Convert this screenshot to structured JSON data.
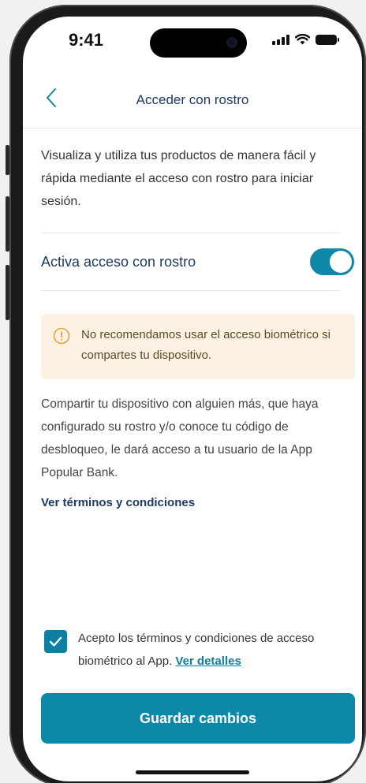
{
  "status": {
    "time": "9:41"
  },
  "nav": {
    "title": "Acceder con rostro",
    "back_icon": "chevron-left-icon"
  },
  "intro": "Visualiza y utiliza tus productos de manera fácil y rápida mediante el acceso con rostro para iniciar sesión.",
  "face_access": {
    "label": "Activa acceso con rostro",
    "enabled": true
  },
  "warning": {
    "icon": "warning-circle-icon",
    "text": "No recomendamos usar el acceso biométrico si compartes tu dispositivo."
  },
  "body": "Compartir tu dispositivo con alguien más, que haya configurado su rostro y/o conoce tu código de desbloqueo, le dará acceso a tu usuario de la App Popular Bank.",
  "terms_link": "Ver términos y condiciones",
  "accept": {
    "checked": true,
    "text": "Acepto los términos y condiciones de acceso biométrico al App.",
    "details_link": "Ver detalles"
  },
  "save_button": "Guardar cambios",
  "colors": {
    "accent": "#0e88a8",
    "navy": "#1d3a63",
    "warning_bg": "#fcf1e3",
    "warning_icon": "#e6a23c"
  }
}
